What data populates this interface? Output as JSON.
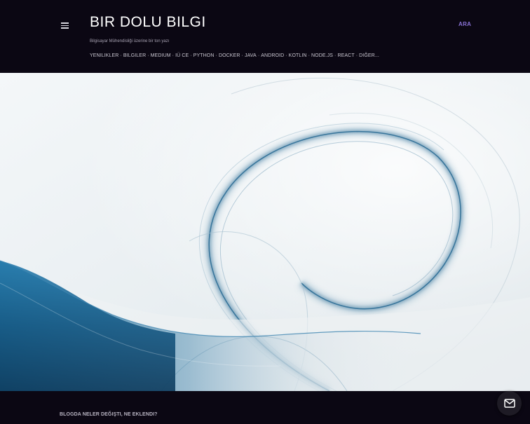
{
  "header": {
    "menu_icon": "hamburger-menu-icon",
    "title": "BIR DOLU BILGI",
    "tagline": "Bilgisayar Mühendisliği üzerine bir ton yazı",
    "search_label": "ARA",
    "search_color": "#8a72d6"
  },
  "nav": {
    "items": [
      "YENILIKLER",
      "BILGILER",
      "MEDIUM",
      "IÜ CE",
      "PYTHON",
      "DOCKER",
      "JAVA",
      "ANDROID",
      "KOTLIN",
      "NODE.JS",
      "REACT",
      "DIĞER..."
    ],
    "separator": "·"
  },
  "hero": {
    "image": "abstract-blue-swirl-background"
  },
  "footer": {
    "section_title": "BLOGDA NELER DEĞIŞTI, NE EKLENDI?",
    "fab_icon": "mail-icon"
  },
  "colors": {
    "background": "#0b0713",
    "accent": "#8a72d6",
    "hero_blue": "#1f6e9a"
  }
}
